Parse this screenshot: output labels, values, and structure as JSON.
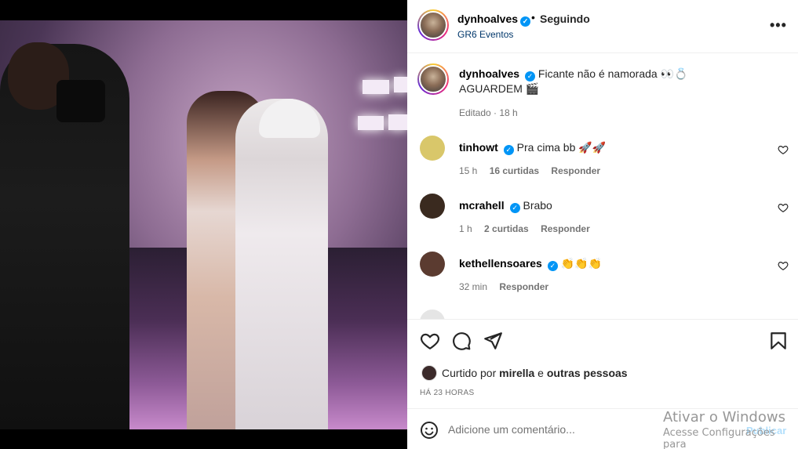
{
  "post": {
    "username": "dynhoalves",
    "follow_status": "Seguindo",
    "dot": "•",
    "subtitle": "GR6 Eventos",
    "more_label": "•••"
  },
  "caption": {
    "username": "dynhoalves",
    "text": "Ficante não é namorada 👀💍",
    "text2": "AGUARDEM 🎬",
    "meta": "Editado · 18 h"
  },
  "comments": [
    {
      "username": "tinhowt",
      "text": "Pra cima bb 🚀🚀",
      "time": "15 h",
      "replies": "16 curtidas",
      "reply_label": "Responder",
      "avatar_color": "#d9c76a"
    },
    {
      "username": "mcrahell",
      "text": "Brabo",
      "time": "1 h",
      "replies": "2 curtidas",
      "reply_label": "Responder",
      "avatar_color": "#3a2a1f"
    },
    {
      "username": "kethellensoares",
      "text": "👏👏👏",
      "time": "32 min",
      "replies": "",
      "reply_label": "Responder",
      "avatar_color": "#5b3b30"
    }
  ],
  "likes": {
    "prefix": "Curtido por ",
    "user": "mirella",
    "middle": " e ",
    "others": "outras pessoas"
  },
  "timestamp": "HÁ 23 HORAS",
  "add_comment": {
    "placeholder": "Adicione um comentário...",
    "publish": "Publicar"
  },
  "watermark": {
    "line1": "Ativar o Windows",
    "line2": "Acesse Configurações para"
  },
  "icons": [
    "heart-icon",
    "comment-icon",
    "share-icon",
    "bookmark-icon",
    "emoji-icon",
    "more-icon",
    "verified-icon"
  ],
  "colors": {
    "verified": "#0095f6",
    "link": "#00376b",
    "muted": "#737373",
    "publish_disabled": "#b2dffc"
  }
}
